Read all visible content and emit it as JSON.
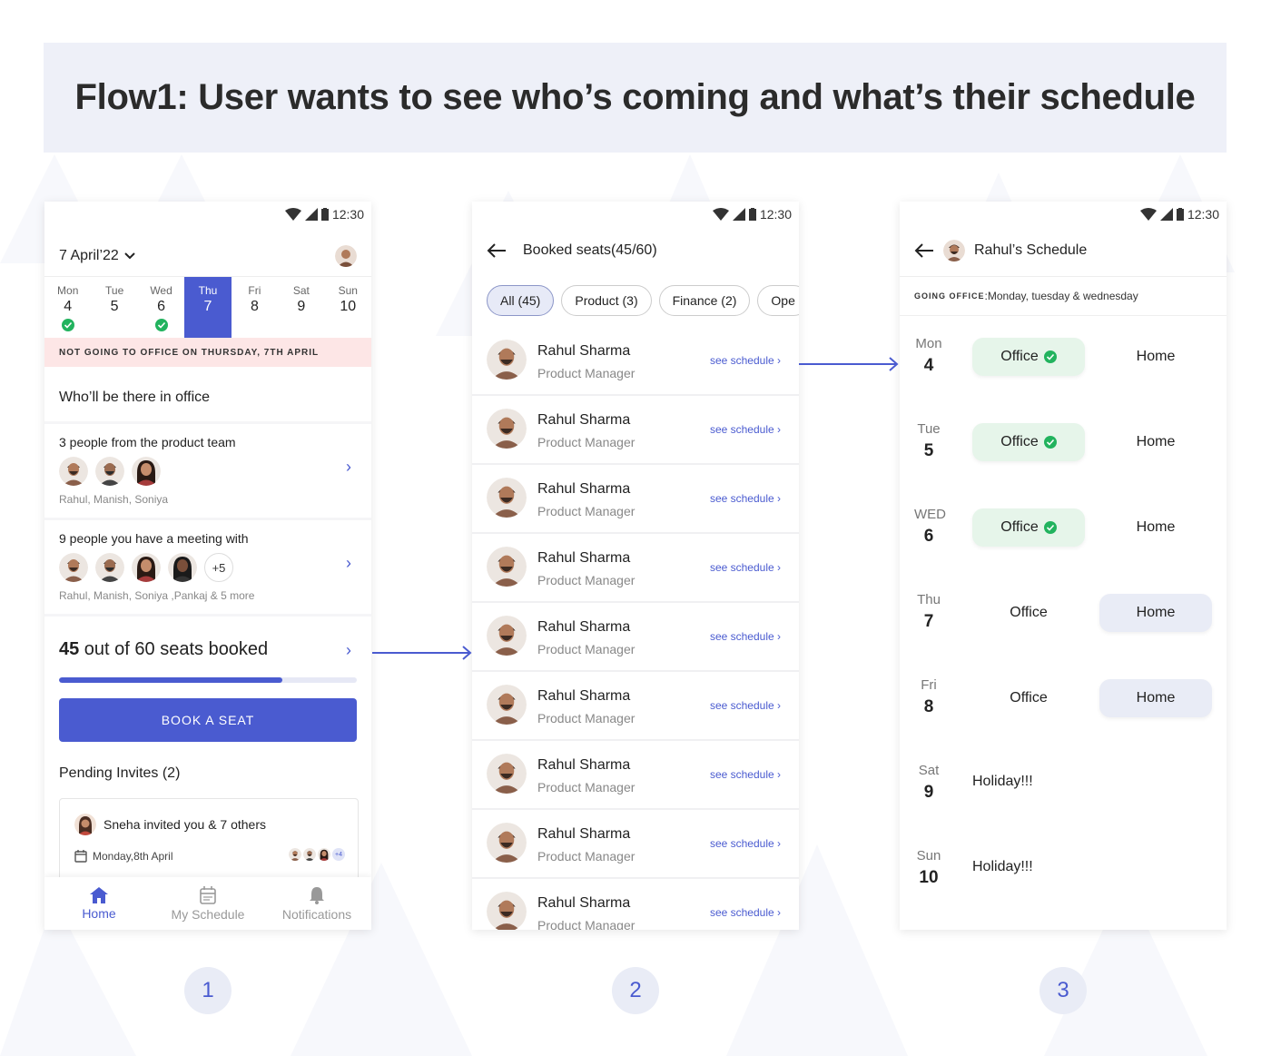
{
  "banner": {
    "title": "Flow1: User wants to see who’s coming and what’s their schedule"
  },
  "colors": {
    "accent": "#4a5bd0",
    "alert_bg": "#fde6e6",
    "office_bg": "#e6f5ea",
    "home_bg": "#e9ecf6",
    "check": "#22b35e"
  },
  "status_bar": {
    "time": "12:30"
  },
  "screen1": {
    "date_label": "7 April’22",
    "week": [
      {
        "name": "Mon",
        "num": "4",
        "booked": true
      },
      {
        "name": "Tue",
        "num": "5",
        "booked": false
      },
      {
        "name": "Wed",
        "num": "6",
        "booked": true
      },
      {
        "name": "Thu",
        "num": "7",
        "booked": false,
        "selected": true
      },
      {
        "name": "Fri",
        "num": "8",
        "booked": false
      },
      {
        "name": "Sat",
        "num": "9",
        "booked": false
      },
      {
        "name": "Sun",
        "num": "10",
        "booked": false
      }
    ],
    "alert": "NOT GOING TO OFFICE ON THURSDAY, 7TH APRIL",
    "who_title": "Who’ll be there in office",
    "group1": {
      "title": "3 people from the product team",
      "names": "Rahul, Manish, Soniya"
    },
    "group2": {
      "title": "9 people you have a meeting with",
      "names": "Rahul, Manish, Soniya ,Pankaj & 5 more",
      "more": "+5"
    },
    "seats_booked": "45",
    "seats_text": " out of 60 seats booked",
    "seats_fraction": 0.75,
    "book_button": "BOOK A SEAT",
    "pending_title": "Pending Invites (2)",
    "invite": {
      "text": "Sneha invited you & 7 others",
      "date": "Monday,8th April",
      "more": "+4"
    },
    "nav": [
      {
        "label": "Home",
        "icon": "home-icon",
        "active": true
      },
      {
        "label": "My Schedule",
        "icon": "calendar-icon",
        "active": false
      },
      {
        "label": "Notifications",
        "icon": "bell-icon",
        "active": false
      }
    ]
  },
  "screen2": {
    "title": "Booked seats(45/60)",
    "chips": [
      {
        "label": "All (45)",
        "active": true
      },
      {
        "label": "Product (3)"
      },
      {
        "label": "Finance (2)"
      },
      {
        "label": "Ope"
      }
    ],
    "rows": [
      {
        "name": "Rahul Sharma",
        "role": "Product Manager",
        "link": "see schedule  ›"
      },
      {
        "name": "Rahul Sharma",
        "role": "Product Manager",
        "link": "see schedule  ›"
      },
      {
        "name": "Rahul Sharma",
        "role": "Product Manager",
        "link": "see schedule  ›"
      },
      {
        "name": "Rahul Sharma",
        "role": "Product Manager",
        "link": "see schedule  ›"
      },
      {
        "name": "Rahul Sharma",
        "role": "Product Manager",
        "link": "see schedule  ›"
      },
      {
        "name": "Rahul Sharma",
        "role": "Product Manager",
        "link": "see schedule  ›"
      },
      {
        "name": "Rahul Sharma",
        "role": "Product Manager",
        "link": "see schedule  ›"
      },
      {
        "name": "Rahul Sharma",
        "role": "Product Manager",
        "link": "see schedule  ›"
      },
      {
        "name": "Rahul Sharma",
        "role": "Product Manager",
        "link": "see schedule  ›"
      }
    ]
  },
  "screen3": {
    "title": "Rahul’s Schedule",
    "going_key": "GOING OFFICE",
    "going_value": ":Monday, tuesday & wednesday",
    "days": [
      {
        "name": "Mon",
        "num": "4",
        "office": "Office",
        "home": "Home",
        "status": "office"
      },
      {
        "name": "Tue",
        "num": "5",
        "office": "Office",
        "home": "Home",
        "status": "office"
      },
      {
        "name": "WED",
        "num": "6",
        "office": "Office",
        "home": "Home",
        "status": "office"
      },
      {
        "name": "Thu",
        "num": "7",
        "office": "Office",
        "home": "Home",
        "status": "home"
      },
      {
        "name": "Fri",
        "num": "8",
        "office": "Office",
        "home": "Home",
        "status": "home"
      },
      {
        "name": "Sat",
        "num": "9",
        "holiday": "Holiday!!!",
        "status": "holiday"
      },
      {
        "name": "Sun",
        "num": "10",
        "holiday": "Holiday!!!",
        "status": "holiday"
      }
    ]
  },
  "steps": [
    "1",
    "2",
    "3"
  ]
}
